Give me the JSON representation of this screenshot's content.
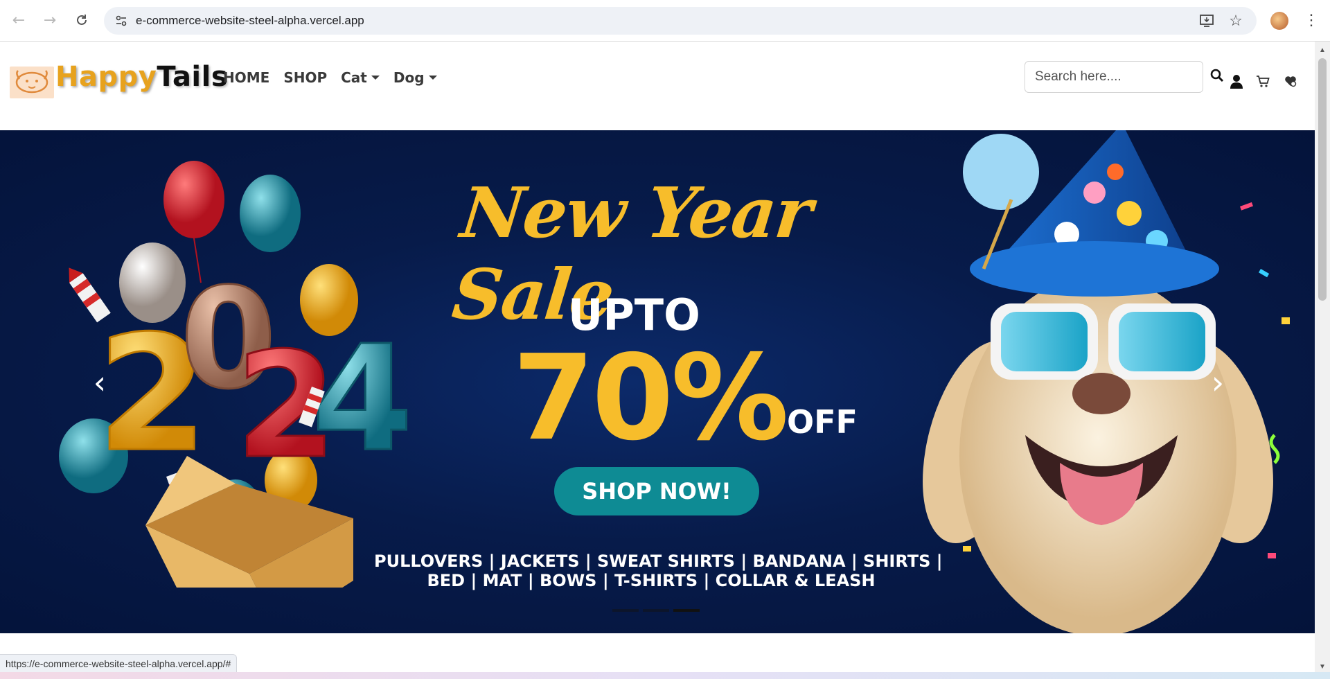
{
  "browser": {
    "url": "e-commerce-website-steel-alpha.vercel.app",
    "status_url": "https://e-commerce-website-steel-alpha.vercel.app/#",
    "icons": {
      "back": "back-arrow-icon",
      "forward": "forward-arrow-icon",
      "reload": "reload-icon",
      "site_info": "tune-icon",
      "install": "install-app-icon",
      "bookmark": "star-icon",
      "menu": "kebab-menu-icon"
    }
  },
  "site": {
    "logo_part1": "Happy",
    "logo_part2": "Tails",
    "nav": {
      "home": "HOME",
      "shop": "SHOP",
      "cat": "Cat",
      "dog": "Dog"
    },
    "search_placeholder": "Search here....",
    "icons": [
      "search-icon",
      "user-icon",
      "cart-icon",
      "wishlist-icon"
    ]
  },
  "hero": {
    "title": "New Year Sale",
    "upto": "UPTO",
    "percent": "70%",
    "off": "OFF",
    "cta": "SHOP NOW!",
    "categories_line1": "PULLOVERS | JACKETS | SWEAT SHIRTS | BANDANA | SHIRTS |",
    "categories_line2": "BED | MAT | BOWS | T-SHIRTS | COLLAR & LEASH",
    "slides_total": 3,
    "active_slide": 3
  },
  "colors": {
    "accent_yellow": "#f7bd2b",
    "cta_teal": "#0e8b94",
    "hero_bg": "#071b4a",
    "logo_orange": "#e7a21e"
  }
}
